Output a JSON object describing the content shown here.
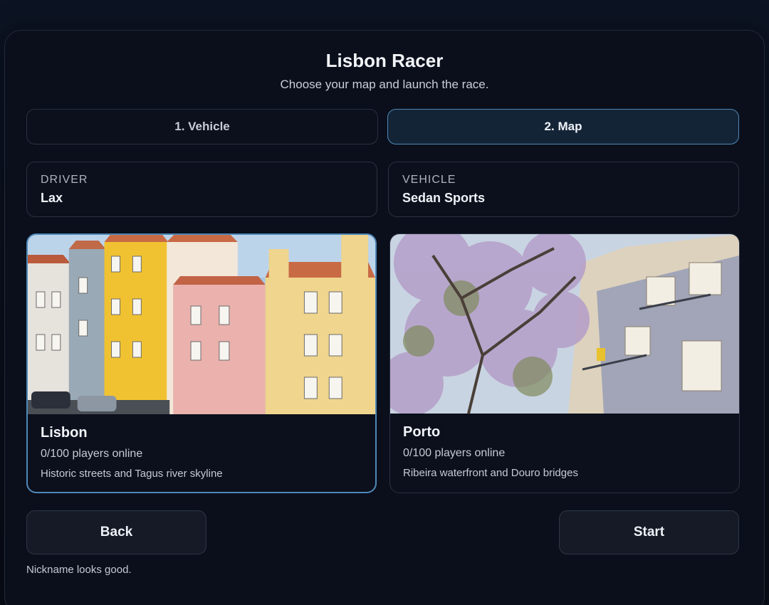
{
  "header": {
    "title": "Lisbon Racer",
    "subtitle": "Choose your map and launch the race."
  },
  "steps": [
    {
      "label": "1. Vehicle",
      "active": false
    },
    {
      "label": "2. Map",
      "active": true
    }
  ],
  "info": {
    "driver_label": "DRIVER",
    "driver_value": "Lax",
    "vehicle_label": "VEHICLE",
    "vehicle_value": "Sedan Sports"
  },
  "maps": [
    {
      "name": "Lisbon",
      "players": "0/100 players online",
      "description": "Historic streets and Tagus river skyline",
      "selected": true
    },
    {
      "name": "Porto",
      "players": "0/100 players online",
      "description": "Ribeira waterfront and Douro bridges",
      "selected": false
    }
  ],
  "actions": {
    "back_label": "Back",
    "start_label": "Start"
  },
  "status_text": "Nickname looks good.",
  "colors": {
    "accent": "#4f88b8",
    "background": "#0a0f1b",
    "card": "#0b101c"
  }
}
